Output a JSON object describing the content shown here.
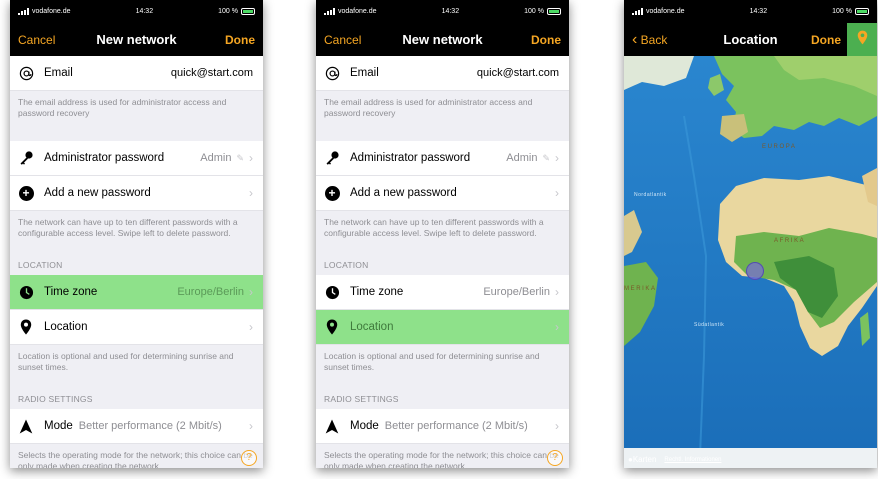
{
  "status": {
    "carrier": "vodafone.de",
    "time": "14:32",
    "battery": "100 %"
  },
  "screen1": {
    "nav": {
      "cancel": "Cancel",
      "title": "New network",
      "done": "Done"
    },
    "email": {
      "label": "Email",
      "value": "quick@start.com"
    },
    "email_note": "The email address is used for administrator access and password recovery",
    "admin": {
      "label": "Administrator password",
      "value": "Admin"
    },
    "add_password": {
      "label": "Add a new password"
    },
    "password_note": "The network can have up to ten different passwords with a configurable access level. Swipe left to delete password.",
    "location_section": "LOCATION",
    "timezone": {
      "label": "Time zone",
      "value": "Europe/Berlin"
    },
    "location": {
      "label": "Location"
    },
    "location_note": "Location is optional and used for determining sunrise and sunset times.",
    "radio_section": "RADIO SETTINGS",
    "mode": {
      "label": "Mode",
      "value": "Better performance (2 Mbit/s)"
    },
    "mode_note": "Selects the operating mode for the network; this choice can be only made when creating the network.",
    "help": "?"
  },
  "screen3": {
    "nav": {
      "back": "Back",
      "title": "Location",
      "done": "Done"
    },
    "map_labels": {
      "europa": "EUROPA",
      "afrika": "AFRIKA",
      "amerika": "MERIKA",
      "nordatlantik": "Nordatlantik",
      "suedatlantik": "Südatlantik"
    },
    "footer": {
      "brand": "Karten",
      "legal": "Rechtl. Informationen"
    }
  },
  "colors": {
    "accent": "#f5a623",
    "highlight": "#8ee18a",
    "pin": "#4caf50"
  },
  "icons": [
    "at-icon",
    "key-icon",
    "plus-circle-icon",
    "clock-icon",
    "location-pin-icon",
    "navigation-arrow-icon",
    "help-icon",
    "chevron-right-icon",
    "chevron-left-icon",
    "pencil-icon"
  ]
}
